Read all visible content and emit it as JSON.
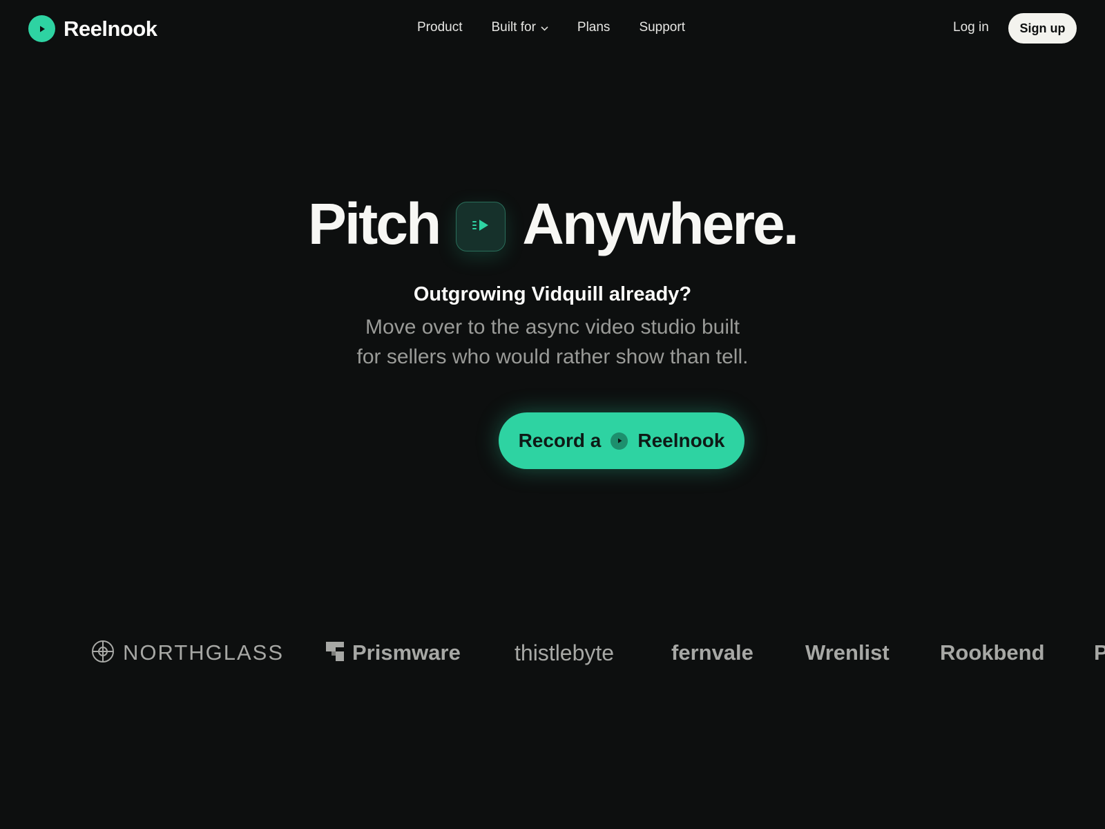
{
  "nav": {
    "brand": "Reelnook",
    "links": [
      {
        "label": "Product"
      },
      {
        "label": "Built for"
      },
      {
        "label": "Plans"
      },
      {
        "label": "Support"
      }
    ],
    "login": "Log in",
    "signup": "Sign up"
  },
  "hero": {
    "headline_left": "Pitch",
    "headline_right": "Anywhere.",
    "subhead": "Outgrowing Vidquill already?",
    "desc_line1": "Move over to the async video studio built",
    "desc_line2": "for sellers who would rather show than tell.",
    "cta_prefix": "Record a",
    "cta_suffix": "Reelnook"
  },
  "logos": [
    {
      "name": "NORTHGLASS",
      "icon": "crosshair-circle-icon"
    },
    {
      "name": "Prismware",
      "icon": "stacked-squares-icon"
    },
    {
      "name": "thistlebyte"
    },
    {
      "name": "fernvale"
    },
    {
      "name": "Wrenlist"
    },
    {
      "name": "Rookbend"
    },
    {
      "name": "P"
    }
  ],
  "colors": {
    "background": "#0d0f0f",
    "accent": "#2ed3a2",
    "text": "#f4f4f2",
    "muted": "#9a9b98",
    "logo": "#a7a8a5"
  }
}
